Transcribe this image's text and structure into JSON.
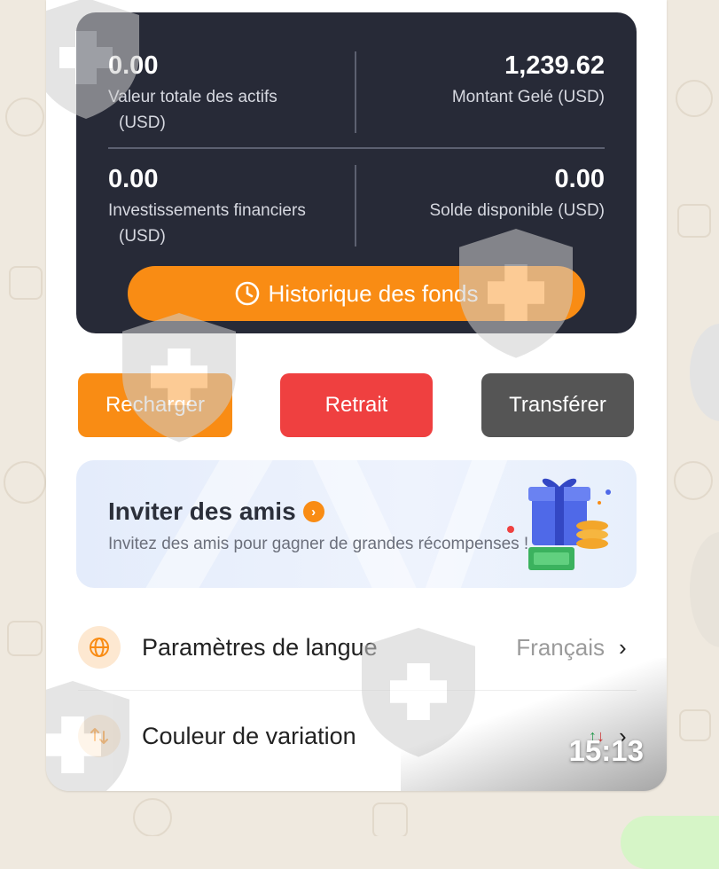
{
  "assets": {
    "total_value": {
      "value": "0.00",
      "label": "Valeur totale des actifs",
      "unit": "(USD)"
    },
    "frozen": {
      "value": "1,239.62",
      "label": "Montant Gelé",
      "unit": "(USD)"
    },
    "investments": {
      "value": "0.00",
      "label": "Investissements financiers",
      "unit": "(USD)"
    },
    "available": {
      "value": "0.00",
      "label": "Solde disponible",
      "unit": "(USD)"
    },
    "history_button": "Historique des fonds"
  },
  "actions": {
    "recharge": "Recharger",
    "withdraw": "Retrait",
    "transfer": "Transférer"
  },
  "invite": {
    "title": "Inviter des amis",
    "subtitle": "Invitez des amis pour gagner de grandes récompenses !"
  },
  "settings": {
    "language": {
      "label": "Paramètres de langue",
      "value": "Français",
      "icon": "globe-icon"
    },
    "color": {
      "label": "Couleur de variation",
      "icon": "swap-icon"
    }
  },
  "message": {
    "time": "15:13"
  },
  "colors": {
    "accent": "#f98c14",
    "danger": "#ef4040",
    "neutral": "#555555",
    "card": "#272a37"
  }
}
